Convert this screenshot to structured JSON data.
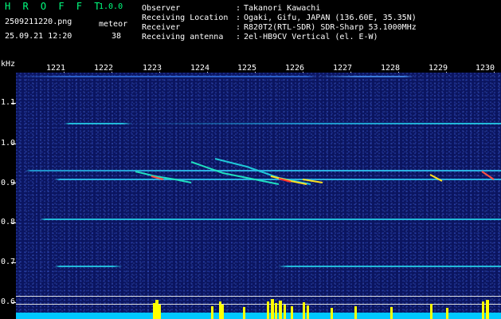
{
  "header": {
    "app_title": "H R O F F T",
    "app_version": "1.0.0",
    "filename": "2509211220.png",
    "timestamp": "25.09.21 12:20",
    "meteor_label": "meteor",
    "meteor_count": "38"
  },
  "station": {
    "rows": [
      {
        "label": "Observer",
        "value": "Takanori Kawachi"
      },
      {
        "label": "Receiving Location",
        "value": "Ogaki, Gifu, JAPAN (136.60E, 35.35N)"
      },
      {
        "label": "Receiver",
        "value": "R820T2(RTL-SDR) SDR-Sharp 53.1000MHz"
      },
      {
        "label": "Receiving antenna",
        "value": "2el-HB9CV Vertical (el. E-W)"
      }
    ],
    "separator": ":"
  },
  "spectrogram": {
    "y_unit": "kHz",
    "y_ticks": [
      "1.1",
      "1.0",
      "0.9",
      "0.8",
      "0.7",
      "0.6"
    ],
    "x_ticks": [
      "1221",
      "1222",
      "1223",
      "1224",
      "1225",
      "1226",
      "1227",
      "1228",
      "1229",
      "1230"
    ],
    "colors": {
      "background": "#0b1560",
      "carrier": "#22b8d8",
      "echo_hot": "#ff3030",
      "echo_warm": "#ffe020",
      "echo_cool": "#20e0c0",
      "baseline": "#00c8ff",
      "activity": "#ffff00"
    }
  }
}
